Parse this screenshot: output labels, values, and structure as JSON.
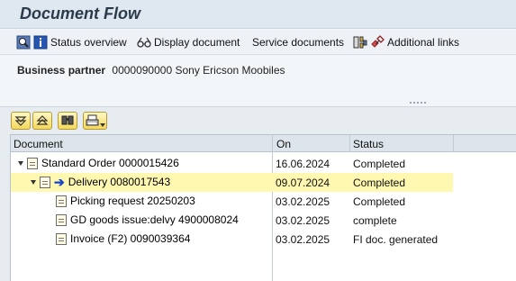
{
  "window": {
    "title": "Document Flow"
  },
  "toolbar": {
    "status_overview": "Status overview",
    "display_document": "Display document",
    "service_documents": "Service documents",
    "additional_links": "Additional links"
  },
  "business_partner": {
    "label": "Business partner",
    "value": "0000090000 Sony Ericson Moobiles"
  },
  "tree": {
    "columns": [
      "Document",
      "On",
      "Status"
    ],
    "rows": [
      {
        "document": "Standard Order 0000015426",
        "on": "16.06.2024",
        "status": "Completed",
        "icon": "document-icon",
        "expanded": true,
        "selected": false
      },
      {
        "document": "Delivery 0080017543",
        "on": "09.07.2024",
        "status": "Completed",
        "icon": "document-icon",
        "expanded": true,
        "selected": true
      },
      {
        "document": "Picking request 20250203",
        "on": "03.02.2025",
        "status": "Completed",
        "icon": "document-icon",
        "selected": false
      },
      {
        "document": "GD goods issue:delvy 4900008024",
        "on": "03.02.2025",
        "status": "complete",
        "icon": "document-icon",
        "selected": false
      },
      {
        "document": "Invoice (F2) 0090039364",
        "on": "03.02.2025",
        "status": "FI doc. generated",
        "icon": "document-icon",
        "selected": false
      }
    ]
  },
  "colors": {
    "selected_row": "#fff8b0",
    "header_bg": "#dfe8f1",
    "arrow": "#1846c8"
  }
}
